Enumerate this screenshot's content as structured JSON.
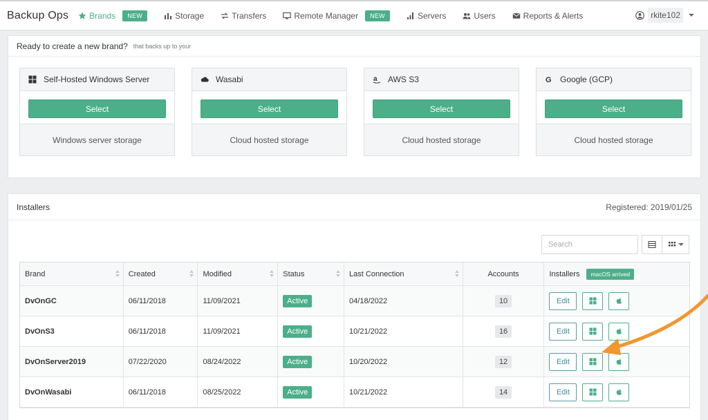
{
  "navbar": {
    "app_title": "Backup Ops",
    "items": [
      {
        "label": "Brands",
        "icon": "star-icon",
        "active": true,
        "badge": "NEW"
      },
      {
        "label": "Storage",
        "icon": "bar-chart-icon"
      },
      {
        "label": "Transfers",
        "icon": "exchange-icon"
      },
      {
        "label": "Remote Manager",
        "icon": "monitor-icon",
        "badge": "NEW"
      },
      {
        "label": "Servers",
        "icon": "signal-icon"
      },
      {
        "label": "Users",
        "icon": "users-icon"
      },
      {
        "label": "Reports & Alerts",
        "icon": "envelope-icon"
      }
    ],
    "user": "rkite102"
  },
  "new_brand": {
    "title": "Ready to create a new brand?",
    "subtitle": "that backs up to your",
    "cards": [
      {
        "name": "Self-Hosted Windows Server",
        "icon": "windows-icon",
        "button": "Select",
        "description": "Windows server storage"
      },
      {
        "name": "Wasabi",
        "icon": "cloud-icon",
        "button": "Select",
        "description": "Cloud hosted storage"
      },
      {
        "name": "AWS S3",
        "icon": "amazon-icon",
        "button": "Select",
        "description": "Cloud hosted storage"
      },
      {
        "name": "Google (GCP)",
        "icon": "google-icon",
        "button": "Select",
        "description": "Cloud hosted storage"
      }
    ]
  },
  "installers": {
    "title": "Installers",
    "registered": "Registered: 2019/01/25",
    "search_placeholder": "Search",
    "columns": [
      "Brand",
      "Created",
      "Modified",
      "Status",
      "Last Connection",
      "Accounts",
      "Installers"
    ],
    "macos_badge": "macOS arrived",
    "edit_label": "Edit",
    "rows": [
      {
        "brand": "DvOnGC",
        "created": "06/11/2018",
        "modified": "11/09/2021",
        "status": "Active",
        "last": "04/18/2022",
        "accounts": "10"
      },
      {
        "brand": "DvOnS3",
        "created": "06/11/2018",
        "modified": "11/09/2021",
        "status": "Active",
        "last": "10/21/2022",
        "accounts": "16"
      },
      {
        "brand": "DvOnServer2019",
        "created": "07/22/2020",
        "modified": "08/24/2022",
        "status": "Active",
        "last": "10/20/2022",
        "accounts": "12"
      },
      {
        "brand": "DvOnWasabi",
        "created": "06/11/2018",
        "modified": "08/25/2022",
        "status": "Active",
        "last": "10/21/2022",
        "accounts": "14"
      }
    ]
  },
  "colors": {
    "accent": "#4caf8a",
    "arrow": "#f0972f"
  }
}
